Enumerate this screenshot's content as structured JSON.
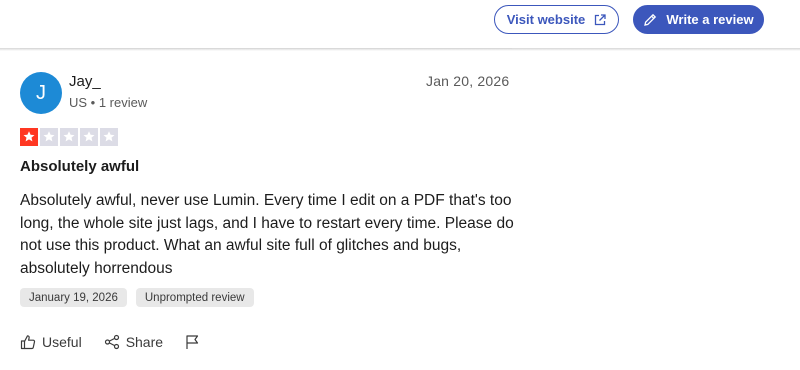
{
  "header": {
    "visit_website_label": "Visit website",
    "write_review_label": "Write a review",
    "accent_color": "#3c57bc"
  },
  "review": {
    "avatar_initial": "J",
    "avatar_color": "#1d8ad6",
    "reviewer_name": "Jay_",
    "reviewer_meta": "US • 1 review",
    "posted_date": "Jan 20, 2026",
    "rating": 1,
    "rating_max": 5,
    "rating_color": "#ff3722",
    "empty_star_color": "#dcdce6",
    "title": "Absolutely awful",
    "text": "Absolutely awful, never use Lumin. Every time I edit on a PDF that's too long, the whole site just lags, and I have to restart every time. Please do not use this product. What an awful site full of glitches and bugs, absolutely horrendous",
    "tags": [
      "January 19, 2026",
      "Unprompted review"
    ]
  },
  "actions": {
    "useful_label": "Useful",
    "share_label": "Share",
    "icons": [
      "thumbs-up-icon",
      "share-icon",
      "flag-icon"
    ]
  }
}
